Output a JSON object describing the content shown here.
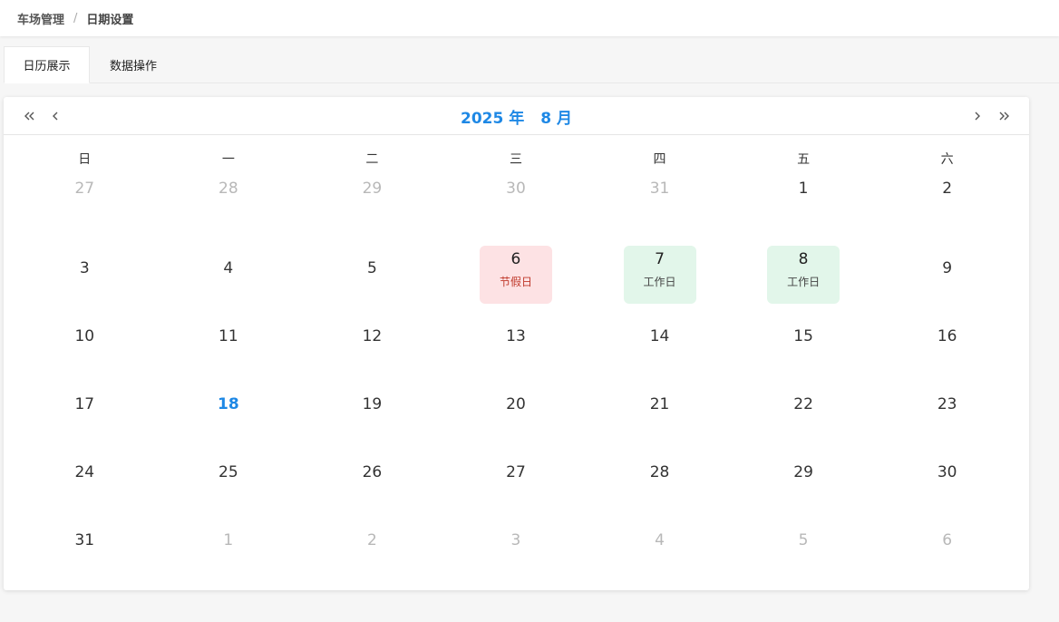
{
  "breadcrumb": {
    "parent": "车场管理",
    "separator": "/",
    "current": "日期设置"
  },
  "tabs": [
    {
      "label": "日历展示",
      "active": true
    },
    {
      "label": "数据操作",
      "active": false
    }
  ],
  "calendar": {
    "year_label": "2025 年",
    "month_label": "8 月",
    "weekdays": [
      "日",
      "一",
      "二",
      "三",
      "四",
      "五",
      "六"
    ],
    "weeks": [
      [
        {
          "day": "27",
          "other": true
        },
        {
          "day": "28",
          "other": true
        },
        {
          "day": "29",
          "other": true
        },
        {
          "day": "30",
          "other": true
        },
        {
          "day": "31",
          "other": true
        },
        {
          "day": "1"
        },
        {
          "day": "2"
        }
      ],
      [
        {
          "day": "3"
        },
        {
          "day": "4"
        },
        {
          "day": "5"
        },
        {
          "day": "6",
          "tag": "节假日",
          "kind": "holiday"
        },
        {
          "day": "7",
          "tag": "工作日",
          "kind": "workday"
        },
        {
          "day": "8",
          "tag": "工作日",
          "kind": "workday"
        },
        {
          "day": "9"
        }
      ],
      [
        {
          "day": "10"
        },
        {
          "day": "11"
        },
        {
          "day": "12"
        },
        {
          "day": "13"
        },
        {
          "day": "14"
        },
        {
          "day": "15"
        },
        {
          "day": "16"
        }
      ],
      [
        {
          "day": "17"
        },
        {
          "day": "18",
          "today": true
        },
        {
          "day": "19"
        },
        {
          "day": "20"
        },
        {
          "day": "21"
        },
        {
          "day": "22"
        },
        {
          "day": "23"
        }
      ],
      [
        {
          "day": "24"
        },
        {
          "day": "25"
        },
        {
          "day": "26"
        },
        {
          "day": "27"
        },
        {
          "day": "28"
        },
        {
          "day": "29"
        },
        {
          "day": "30"
        }
      ],
      [
        {
          "day": "31"
        },
        {
          "day": "1",
          "other": true
        },
        {
          "day": "2",
          "other": true
        },
        {
          "day": "3",
          "other": true
        },
        {
          "day": "4",
          "other": true
        },
        {
          "day": "5",
          "other": true
        },
        {
          "day": "6",
          "other": true
        }
      ]
    ]
  },
  "colors": {
    "accent": "#1e88e5",
    "holiday_bg": "#fde2e4",
    "holiday_text": "#c0392b",
    "workday_bg": "#e2f6ea",
    "other_month_text": "#b8b8b8"
  },
  "icons": {
    "prev_year": "double-chevron-left-icon",
    "prev_month": "chevron-left-icon",
    "next_month": "chevron-right-icon",
    "next_year": "double-chevron-right-icon"
  }
}
